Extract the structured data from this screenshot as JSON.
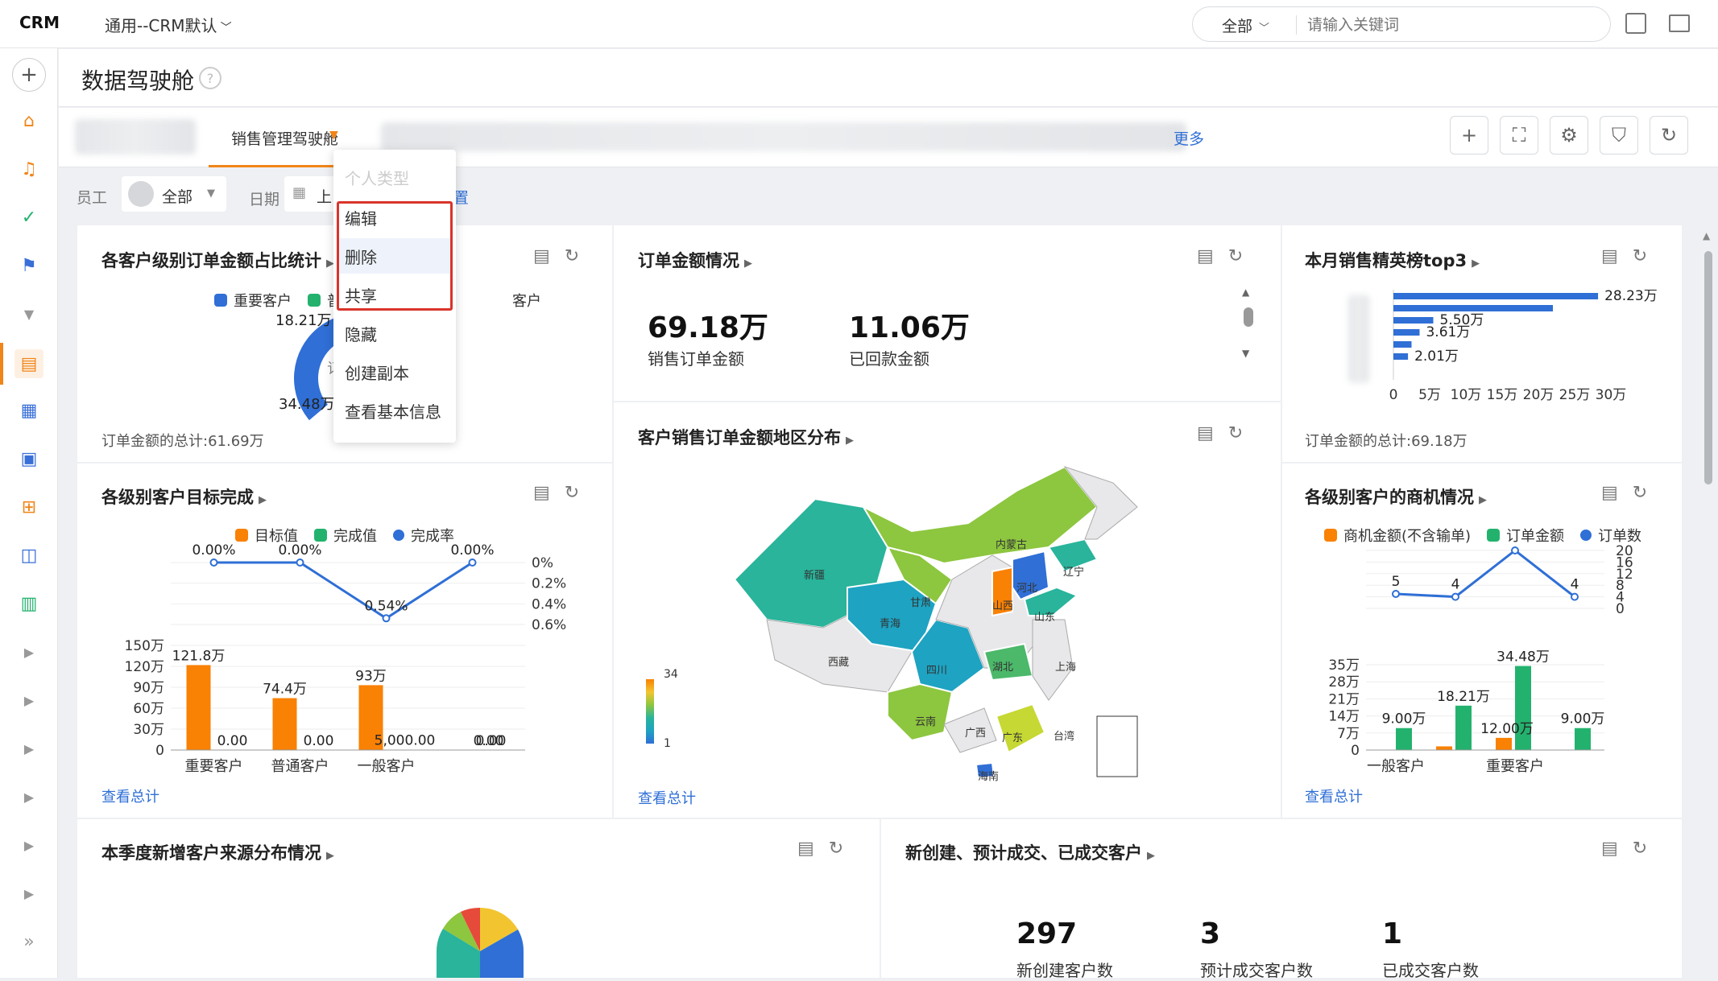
{
  "topbar": {
    "logo": "CRM",
    "workspace": "通用--CRM默认",
    "search_scope": "全部",
    "search_placeholder": "请输入关键词"
  },
  "sidebar": {
    "icons": [
      "plus-icon",
      "home-icon",
      "bell-icon",
      "check-circle-icon",
      "flag-icon",
      "chevron-down-icon",
      "dashboard-icon",
      "calendar-icon",
      "report-icon",
      "add-doc-icon",
      "analysis-icon",
      "document-icon",
      "chevron-right-icon",
      "chevron-right-icon",
      "chevron-right-icon",
      "chevron-right-icon",
      "chevron-right-icon",
      "chevron-right-icon",
      "expand-icon"
    ]
  },
  "page": {
    "title": "数据驾驶舱",
    "help": "?"
  },
  "tabs": {
    "active": "销售管理驾驶舱",
    "more": "更多"
  },
  "filters": {
    "employee_label": "员工",
    "employee_value": "全部",
    "date_label": "日期",
    "date_value": "上",
    "reset_fragment": "置"
  },
  "dropdown": {
    "header": "个人类型",
    "items": [
      "编辑",
      "删除",
      "共享",
      "隐藏",
      "创建副本",
      "查看基本信息"
    ]
  },
  "cards": {
    "customer_level_share": {
      "title": "各客户级别订单金额占比统计",
      "legend": [
        "重要客户",
        "普",
        "客户"
      ],
      "labels": [
        "18.21万",
        "34.48万",
        "订"
      ],
      "footer": "订单金额的总计:61.69万"
    },
    "order_amount": {
      "title": "订单金额情况",
      "sales_amount": "69.18万",
      "sales_label": "销售订单金额",
      "paid_amount": "11.06万",
      "paid_label": "已回款金额"
    },
    "top3": {
      "title": "本月销售精英榜top3",
      "footer": "订单金额的总计:69.18万"
    },
    "target_completion": {
      "title": "各级别客户目标完成",
      "legend": [
        "目标值",
        "完成值",
        "完成率"
      ],
      "link": "查看总计"
    },
    "region_map": {
      "title": "客户销售订单金额地区分布",
      "provinces": [
        "新疆",
        "西藏",
        "青海",
        "甘肃",
        "内蒙古",
        "四川",
        "云南",
        "广西",
        "广东",
        "海南",
        "湖北",
        "山西",
        "河北",
        "山东",
        "辽宁",
        "上海",
        "台湾"
      ],
      "scale_max": "34",
      "scale_min": "1",
      "link": "查看总计"
    },
    "opportunity": {
      "title": "各级别客户的商机情况",
      "legend": [
        "商机金额(不含输单)",
        "订单金额",
        "订单数"
      ],
      "link": "查看总计"
    },
    "source_dist": {
      "title": "本季度新增客户来源分布情况"
    },
    "deal_stats": {
      "title": "新创建、预计成交、已成交客户",
      "new_count": "297",
      "new_label": "新创建客户数",
      "expected_count": "3",
      "expected_label": "预计成交客户数",
      "closed_count": "1",
      "closed_label": "已成交客户数"
    }
  },
  "colors": {
    "accent": "#f08519",
    "blue": "#2f6fd6",
    "green": "#23b26d",
    "highlight": "#d9342b"
  },
  "chart_data": [
    {
      "type": "bar",
      "chart": "top3",
      "orientation": "horizontal",
      "values": [
        28.23,
        22,
        5.5,
        3.61,
        2.5,
        2.01
      ],
      "labels": [
        "28.23万",
        "",
        "5.50万",
        "3.61万",
        "",
        "2.01万"
      ],
      "xticks": [
        "0",
        "5万",
        "10万",
        "15万",
        "20万",
        "25万",
        "30万"
      ],
      "xlim": [
        0,
        30
      ]
    },
    {
      "type": "bar",
      "chart": "target_completion",
      "categories": [
        "重要客户",
        "普通客户",
        "一般客户",
        ""
      ],
      "series": [
        {
          "name": "目标值",
          "values": [
            121.8,
            74.4,
            93,
            0
          ],
          "labels": [
            "121.8万",
            "74.4万",
            "93万",
            ""
          ]
        },
        {
          "name": "完成值",
          "values": [
            0,
            0,
            0.5,
            0
          ],
          "labels": [
            "0.00",
            "0.00",
            "5,000.00",
            "0.00"
          ]
        },
        {
          "name": "完成率",
          "values": [
            0,
            0,
            0.54,
            0
          ],
          "labels": [
            "0.00%",
            "0.00%",
            "0.54%",
            "0.00%"
          ]
        }
      ],
      "extra_labels": [
        "0.00"
      ],
      "yticks_left": [
        "0",
        "30万",
        "60万",
        "90万",
        "120万",
        "150万"
      ],
      "yticks_right": [
        "0%",
        "0.2%",
        "0.4%",
        "0.6%"
      ],
      "ylim": [
        0,
        150
      ]
    },
    {
      "type": "bar",
      "chart": "opportunity",
      "categories": [
        "一般客户",
        "",
        "重要客户",
        ""
      ],
      "series": [
        {
          "name": "商机金额(不含输单)",
          "values": [
            0,
            1.5,
            5,
            0
          ]
        },
        {
          "name": "订单金额",
          "values": [
            9,
            18.21,
            34.48,
            9
          ],
          "labels": [
            "9.00万",
            "18.21万",
            "34.48万",
            "9.00万"
          ]
        },
        {
          "name": "订单数",
          "values": [
            5,
            4,
            20,
            4
          ],
          "labels": [
            "5",
            "4",
            "20",
            "4"
          ]
        }
      ],
      "extra_labels": [
        "12.00万"
      ],
      "yticks_left": [
        "0",
        "7万",
        "14万",
        "21万",
        "28万",
        "35万"
      ],
      "yticks_right": [
        "0",
        "4",
        "8",
        "12",
        "16",
        "20"
      ],
      "ylim": [
        0,
        35
      ]
    }
  ]
}
